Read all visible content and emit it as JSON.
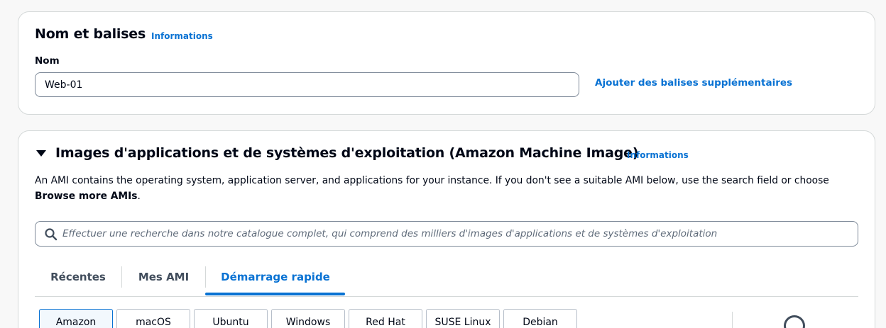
{
  "name_section": {
    "title": "Nom et balises",
    "info_link": "Informations",
    "name_label": "Nom",
    "name_value": "Web-01",
    "add_tags_link": "Ajouter des balises supplémentaires"
  },
  "ami_section": {
    "title": "Images d'applications et de systèmes d'exploitation (Amazon Machine Image)",
    "info_link": "Informations",
    "description_line1": "An AMI contains the operating system, application server, and applications for your instance. If you don't see a suitable AMI below, use the search field or choose",
    "description_bold": "Browse more AMIs",
    "description_end": ".",
    "search_placeholder": "Effectuer une recherche dans notre catalogue complet, qui comprend des milliers d'images d'applications et de systèmes d'exploitation",
    "tabs": [
      "Récentes",
      "Mes AMI",
      "Démarrage rapide"
    ],
    "active_tab": "Démarrage rapide",
    "os_options": [
      "Amazon",
      "macOS",
      "Ubuntu",
      "Windows",
      "Red Hat",
      "SUSE Linux",
      "Debian"
    ],
    "selected_os": "Amazon"
  },
  "colors": {
    "link": "#0972d3",
    "text": "#000716",
    "border": "#d5d9d9"
  }
}
